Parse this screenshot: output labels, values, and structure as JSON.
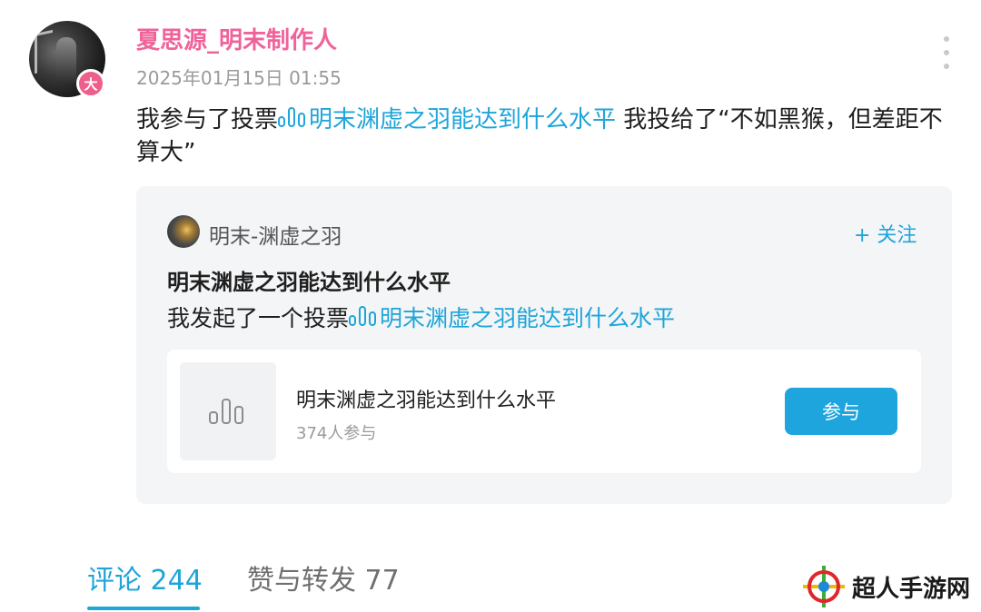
{
  "post": {
    "username": "夏思源_明末制作人",
    "badge": "大",
    "timestamp": "2025年01月15日 01:55",
    "text_prefix": "我参与了投票",
    "vote_link": "明末渊虚之羽能达到什么水平",
    "text_suffix": " 我投给了“不如黑猴，但差距不算大”"
  },
  "card": {
    "channel_name": "明末-渊虚之羽",
    "follow_label": "+ 关注",
    "title": "明末渊虚之羽能达到什么水平",
    "line_prefix": "我发起了一个投票",
    "line_link": "明末渊虚之羽能达到什么水平",
    "poll": {
      "title": "明末渊虚之羽能达到什么水平",
      "participants": "374人参与",
      "join_label": "参与"
    }
  },
  "tabs": {
    "comments": "评论 244",
    "likes_reposts": "赞与转发 77"
  },
  "watermark": {
    "text": "超人手游网"
  },
  "colors": {
    "username": "#f0629a",
    "link": "#1ea5d9",
    "badge": "#ef5f8b",
    "button": "#1ea5dd"
  }
}
